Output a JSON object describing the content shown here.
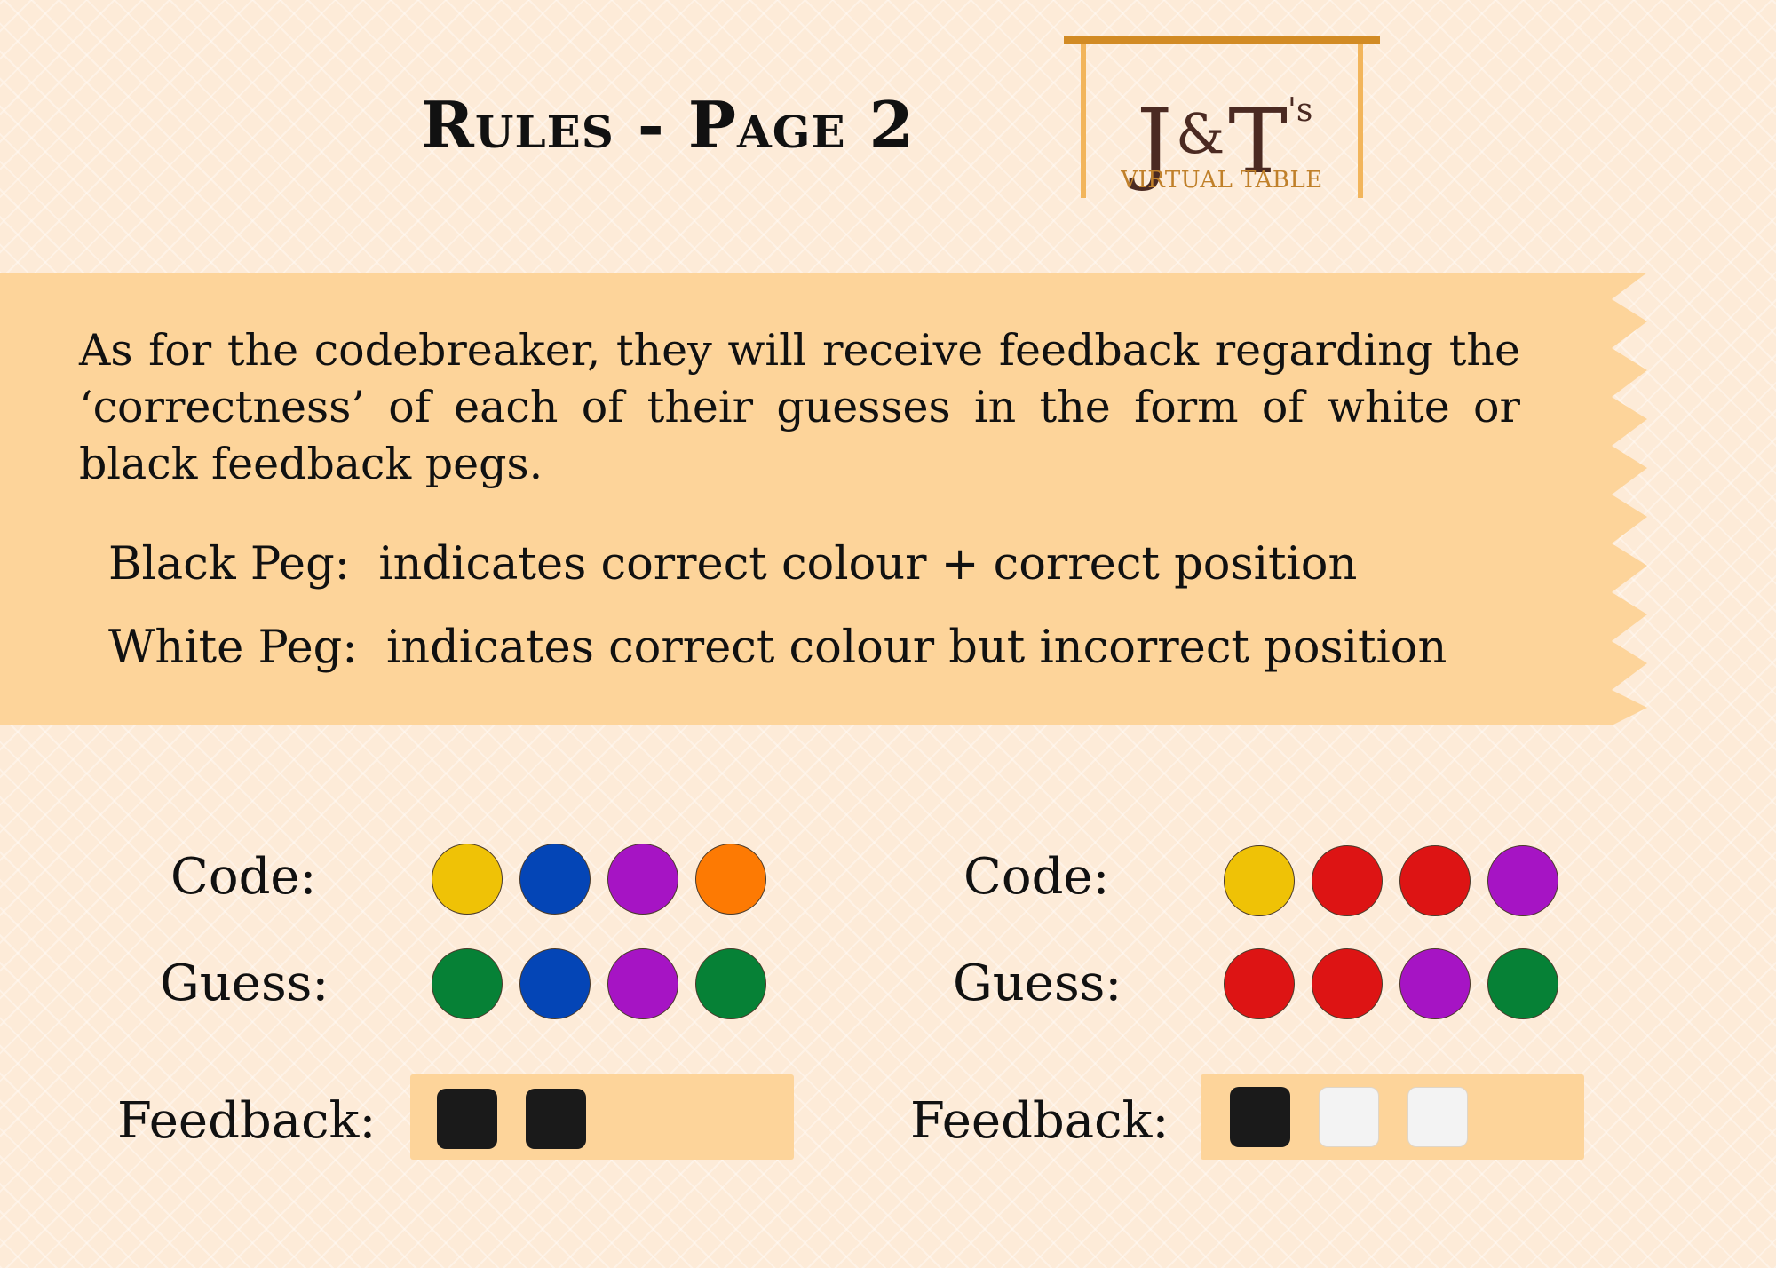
{
  "header": {
    "title": "Rules - Page 2"
  },
  "logo": {
    "brand": "J&T's",
    "brand_j": "J",
    "brand_amp": "&",
    "brand_t": "T",
    "brand_s": "'s",
    "subtitle": "VIRTUAL TABLE"
  },
  "intro": {
    "paragraph": "As for the codebreaker, they will receive feedback regarding the ‘correctness’ of each of their guesses in the form of white or black feedback pegs."
  },
  "rules": [
    {
      "label": "Black Peg:",
      "text": "indicates correct colour + correct position"
    },
    {
      "label": "White Peg:",
      "text": "indicates correct colour but incorrect position"
    }
  ],
  "examples": [
    {
      "code_label": "Code:",
      "guess_label": "Guess:",
      "feedback_label": "Feedback:",
      "code": [
        "yellow",
        "blue",
        "purple",
        "orange"
      ],
      "guess": [
        "green",
        "blue",
        "purple",
        "green"
      ],
      "feedback": [
        "black",
        "black"
      ]
    },
    {
      "code_label": "Code:",
      "guess_label": "Guess:",
      "feedback_label": "Feedback:",
      "code": [
        "yellow",
        "red",
        "red",
        "purple"
      ],
      "guess": [
        "red",
        "red",
        "purple",
        "green"
      ],
      "feedback": [
        "black",
        "white",
        "white"
      ]
    }
  ],
  "colors": {
    "yellow": "#efc206",
    "blue": "#0445b6",
    "purple": "#a614c4",
    "orange": "#fd7a03",
    "green": "#068136",
    "red": "#dd1414",
    "black": "#1a1a1a",
    "white": "#f3f3f3",
    "banner": "#fdd49a",
    "logo_brand": "#4b2a22",
    "logo_accent": "#d28b24"
  }
}
